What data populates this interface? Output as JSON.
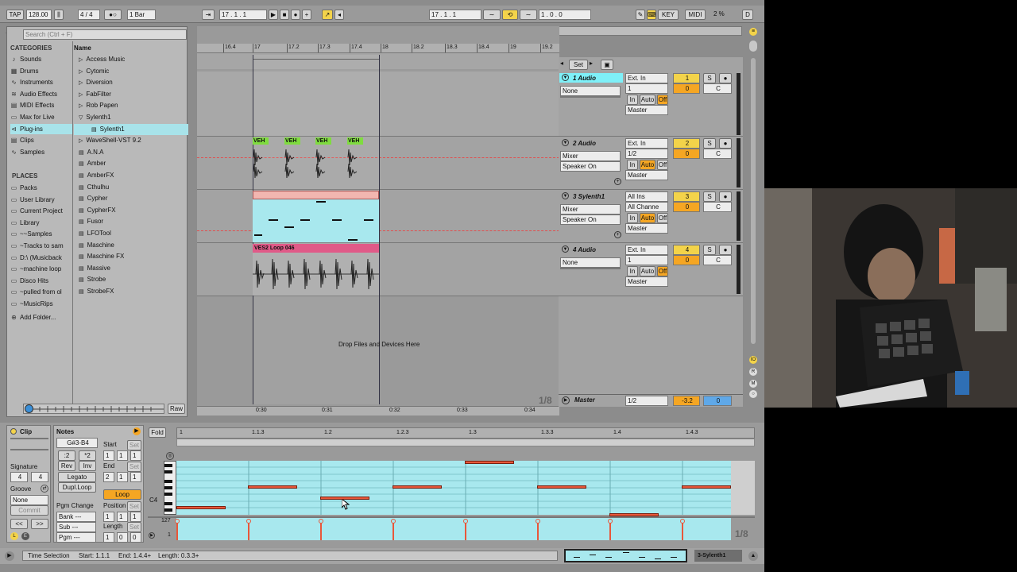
{
  "topbar": {
    "tap": "TAP",
    "tempo": "128.00",
    "meter": "4 / 4",
    "quantize": "1 Bar",
    "position": "17 .  1 .  1",
    "loop_start": "17 .  1 .  1",
    "loop_length": "1 .  0 .  0",
    "key": "KEY",
    "midi": "MIDI",
    "cpu": "2 %",
    "d": "D"
  },
  "browser": {
    "search_placeholder": "Search (Ctrl + F)",
    "categories_header": "CATEGORIES",
    "categories": [
      {
        "label": "Sounds",
        "icon": "note-icon"
      },
      {
        "label": "Drums",
        "icon": "drum-icon"
      },
      {
        "label": "Instruments",
        "icon": "instrument-icon"
      },
      {
        "label": "Audio Effects",
        "icon": "audio-fx-icon"
      },
      {
        "label": "MIDI Effects",
        "icon": "midi-fx-icon"
      },
      {
        "label": "Max for Live",
        "icon": "max-icon"
      },
      {
        "label": "Plug-ins",
        "icon": "plugin-icon",
        "selected": true
      },
      {
        "label": "Clips",
        "icon": "clip-icon"
      },
      {
        "label": "Samples",
        "icon": "sample-icon"
      }
    ],
    "places_header": "PLACES",
    "places": [
      "Packs",
      "User Library",
      "Current Project",
      "Library",
      "~~Samples",
      "~Tracks to sam",
      "D:\\ (Musicback",
      "~machine loop",
      "Disco Hits",
      "~pulled from ol",
      "~MusicRips"
    ],
    "add_folder": "Add Folder...",
    "name_header": "Name",
    "items": [
      {
        "label": "Access Music",
        "type": "folder"
      },
      {
        "label": "Cytomic",
        "type": "folder"
      },
      {
        "label": "Diversion",
        "type": "folder"
      },
      {
        "label": "FabFilter",
        "type": "folder"
      },
      {
        "label": "Rob Papen",
        "type": "folder"
      },
      {
        "label": "Sylenth1",
        "type": "folder-open"
      },
      {
        "label": "Sylenth1",
        "type": "plugin",
        "indent": true,
        "selected": true
      },
      {
        "label": "WaveShell-VST 9.2",
        "type": "folder"
      },
      {
        "label": "A.N.A",
        "type": "plugin"
      },
      {
        "label": "Amber",
        "type": "plugin"
      },
      {
        "label": "AmberFX",
        "type": "plugin"
      },
      {
        "label": "Cthulhu",
        "type": "plugin"
      },
      {
        "label": "Cypher",
        "type": "plugin"
      },
      {
        "label": "CypherFX",
        "type": "plugin"
      },
      {
        "label": "Fusor",
        "type": "plugin"
      },
      {
        "label": "LFOTool",
        "type": "plugin"
      },
      {
        "label": "Maschine",
        "type": "plugin"
      },
      {
        "label": "Maschine FX",
        "type": "plugin"
      },
      {
        "label": "Massive",
        "type": "plugin"
      },
      {
        "label": "Strobe",
        "type": "plugin"
      },
      {
        "label": "StrobeFX",
        "type": "plugin"
      }
    ],
    "raw": "Raw"
  },
  "arrangement": {
    "ruler": [
      "16.4",
      "17",
      "17.2",
      "17.3",
      "17.4",
      "18",
      "18.2",
      "18.3",
      "18.4",
      "19",
      "19.2"
    ],
    "time_ruler": [
      "0:30",
      "0:31",
      "0:32",
      "0:33",
      "0:34"
    ],
    "drop_text": "Drop Files and Devices Here",
    "zoom": "1/8",
    "veh_label": "VEH",
    "loop_clip": "VES2 Loop 046",
    "set": "Set"
  },
  "mixer": {
    "tracks": [
      {
        "name": "1 Audio",
        "input_type": "Ext. In",
        "input_chan": "1",
        "sub": "None",
        "num": "1",
        "vol": "0",
        "pan": "C",
        "out": "Master",
        "highlight": true
      },
      {
        "name": "2 Audio",
        "input_type": "Ext. In",
        "input_chan": "1/2",
        "sub": "Mixer",
        "sub2": "Speaker On",
        "num": "2",
        "vol": "0",
        "pan": "C",
        "out": "Master"
      },
      {
        "name": "3 Sylenth1",
        "input_type": "All Ins",
        "input_chan": "All Channe",
        "sub": "Mixer",
        "sub2": "Speaker On",
        "num": "3",
        "vol": "0",
        "pan": "C",
        "out": "Master"
      },
      {
        "name": "4 Audio",
        "input_type": "Ext. In",
        "input_chan": "1",
        "sub": "None",
        "num": "4",
        "vol": "0",
        "pan": "C",
        "out": "Master"
      }
    ],
    "monitor": {
      "in": "In",
      "auto": "Auto",
      "off": "Off"
    },
    "solo": "S",
    "master": {
      "name": "Master",
      "chan": "1/2",
      "vol": "-3.2",
      "pan": "0"
    }
  },
  "clip_panel": {
    "clip": "Clip",
    "signature_label": "Signature",
    "sig_num": "4",
    "sig_den": "4",
    "groove_label": "Groove",
    "groove": "None",
    "commit": "Commit"
  },
  "notes_panel": {
    "notes": "Notes",
    "range": "G#3-B4",
    "div2": ":2",
    "mul2": "*2",
    "rev": "Rev",
    "inv": "Inv",
    "legato": "Legato",
    "dupl": "Dupl.Loop",
    "pgm_change": "Pgm Change",
    "bank": "Bank ---",
    "sub": "Sub ---",
    "pgm": "Pgm ---",
    "start": "Start",
    "start_vals": [
      "1",
      "1",
      "1"
    ],
    "end": "End",
    "end_vals": [
      "2",
      "1",
      "1"
    ],
    "loop": "Loop",
    "position": "Position",
    "pos_vals": [
      "1",
      "1",
      "1"
    ],
    "length": "Length",
    "len_vals": [
      "1",
      "0",
      "0"
    ],
    "set": "Set"
  },
  "piano_roll": {
    "fold": "Fold",
    "ruler": [
      "1",
      "1.1.3",
      "1.2",
      "1.2.3",
      "1.3",
      "1.3.3",
      "1.4",
      "1.4.3"
    ],
    "c4": "C4",
    "vel_max": "127",
    "vel_min": "1",
    "zoom": "1/8"
  },
  "status": {
    "time_selection": "Time Selection",
    "start": "Start: 1.1.1",
    "end": "End: 1.4.4+",
    "length": "Length: 0.3.3+",
    "track": "3-Sylenth1"
  },
  "colors": {
    "accent": "#f5a623",
    "clip_cyan": "#a8e8ee",
    "midi_note": "#e8573a",
    "selection": "#a8e3ea"
  }
}
